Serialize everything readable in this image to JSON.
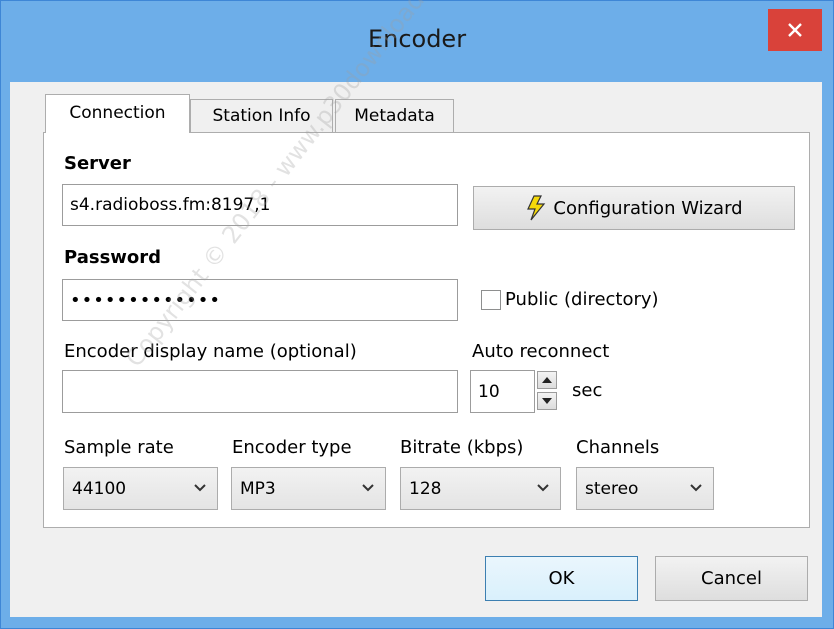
{
  "window": {
    "title": "Encoder",
    "close_glyph": "✕"
  },
  "tabs": [
    {
      "label": "Connection",
      "active": true
    },
    {
      "label": "Station Info",
      "active": false
    },
    {
      "label": "Metadata",
      "active": false
    }
  ],
  "server": {
    "label": "Server",
    "value": "s4.radioboss.fm:8197,1"
  },
  "wizard_button": {
    "label": "Configuration Wizard",
    "icon": "lightning-icon"
  },
  "password": {
    "label": "Password",
    "value": "•••••••••••••"
  },
  "public_directory": {
    "label": "Public (directory)",
    "checked": false
  },
  "encoder_name": {
    "label": "Encoder display name (optional)",
    "value": ""
  },
  "auto_reconnect": {
    "label": "Auto reconnect",
    "value": "10",
    "unit": "sec"
  },
  "selects": {
    "sample_rate": {
      "label": "Sample rate",
      "value": "44100"
    },
    "encoder_type": {
      "label": "Encoder type",
      "value": "MP3"
    },
    "bitrate": {
      "label": "Bitrate (kbps)",
      "value": "128"
    },
    "channels": {
      "label": "Channels",
      "value": "stereo"
    }
  },
  "buttons": {
    "ok": "OK",
    "cancel": "Cancel"
  },
  "watermark": "Copyright © 2018 - www.p30download.com",
  "colors": {
    "titlebar": "#6daee9",
    "close": "#d9423a",
    "accent_border": "#3c7fb1"
  }
}
